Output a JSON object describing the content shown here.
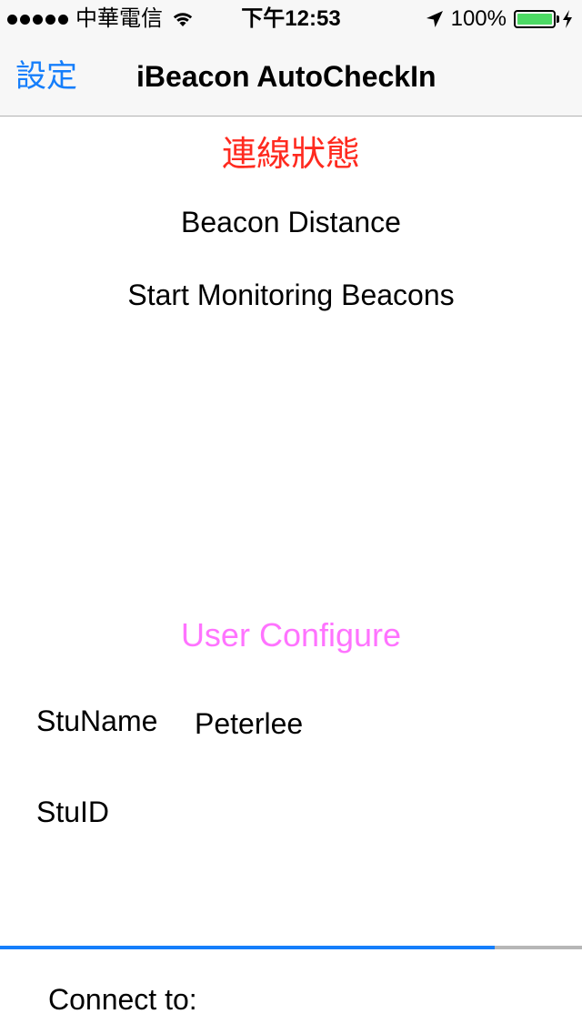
{
  "status_bar": {
    "carrier": "中華電信",
    "time": "下午12:53",
    "battery_percent": "100%",
    "battery_level": 1.0,
    "signal_bars": 5
  },
  "nav": {
    "back_label": "設定",
    "title": "iBeacon AutoCheckIn"
  },
  "main": {
    "connection_status": "連線狀態",
    "beacon_distance": "Beacon Distance",
    "start_monitoring": "Start Monitoring Beacons",
    "user_configure": "User Configure",
    "stuname_label": "StuName",
    "stuname_value": "Peterlee",
    "stuid_label": "StuID",
    "stuid_value": "",
    "progress": 0.85,
    "connect_label": "Connect to:"
  },
  "colors": {
    "accent": "#157efb",
    "status_red": "#ff2a1f",
    "configure_pink": "#ff73ff",
    "battery_green": "#4cd964"
  }
}
